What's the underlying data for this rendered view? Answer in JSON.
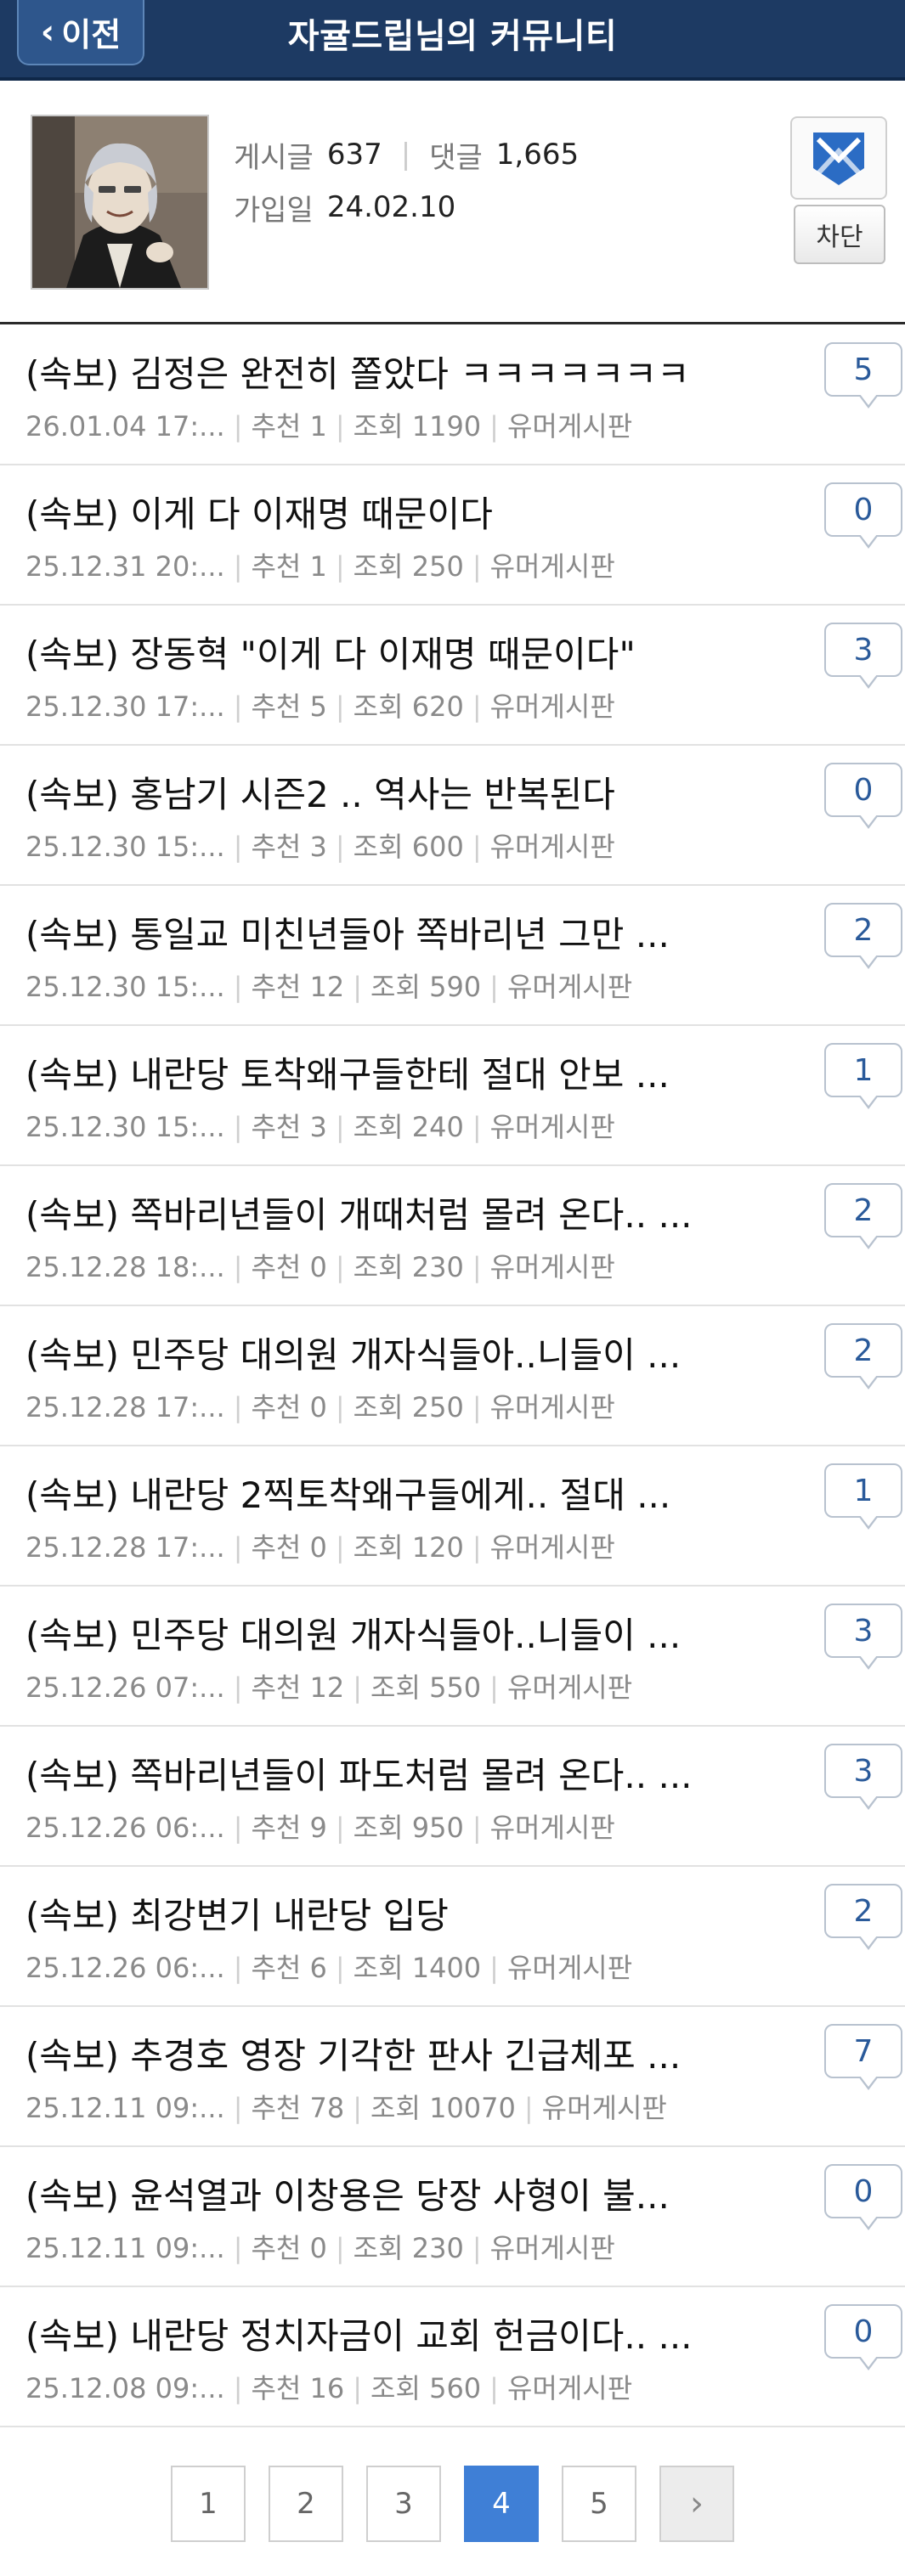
{
  "header": {
    "back_label": "이전",
    "title": "자귤드립님의 커뮤니티"
  },
  "profile": {
    "posts_label": "게시글",
    "posts_value": "637",
    "comments_label": "댓글",
    "comments_value": "1,665",
    "joined_label": "가입일",
    "joined_value": "24.02.10",
    "block_label": "차단"
  },
  "posts": [
    {
      "title": "(속보) 김정은 완전히 쫄았다 ㅋㅋㅋㅋㅋㅋㅋ",
      "date": "26.01.04  17:...",
      "rec": "추천 1",
      "views": "조회 1190",
      "board": "유머게시판",
      "comments": "5"
    },
    {
      "title": "(속보) 이게 다 이재명 때문이다",
      "date": "25.12.31  20:...",
      "rec": "추천 1",
      "views": "조회 250",
      "board": "유머게시판",
      "comments": "0"
    },
    {
      "title": "(속보) 장동혁 \"이게 다 이재명 때문이다\"",
      "date": "25.12.30  17:...",
      "rec": "추천 5",
      "views": "조회 620",
      "board": "유머게시판",
      "comments": "3"
    },
    {
      "title": "(속보) 홍남기 시즌2 .. 역사는 반복된다",
      "date": "25.12.30  15:...",
      "rec": "추천 3",
      "views": "조회 600",
      "board": "유머게시판",
      "comments": "0"
    },
    {
      "title": "(속보) 통일교 미친년들아 쪽바리년 그만 ...",
      "date": "25.12.30  15:...",
      "rec": "추천 12",
      "views": "조회 590",
      "board": "유머게시판",
      "comments": "2"
    },
    {
      "title": "(속보) 내란당 토착왜구들한테 절대 안보 ...",
      "date": "25.12.30  15:...",
      "rec": "추천 3",
      "views": "조회 240",
      "board": "유머게시판",
      "comments": "1"
    },
    {
      "title": "(속보) 쪽바리년들이 개때처럼 몰려 온다.. ...",
      "date": "25.12.28  18:...",
      "rec": "추천 0",
      "views": "조회 230",
      "board": "유머게시판",
      "comments": "2"
    },
    {
      "title": "(속보) 민주당 대의원 개자식들아..니들이 ...",
      "date": "25.12.28  17:...",
      "rec": "추천 0",
      "views": "조회 250",
      "board": "유머게시판",
      "comments": "2"
    },
    {
      "title": "(속보) 내란당 2찍토착왜구들에게.. 절대 ...",
      "date": "25.12.28  17:...",
      "rec": "추천 0",
      "views": "조회 120",
      "board": "유머게시판",
      "comments": "1"
    },
    {
      "title": "(속보) 민주당 대의원 개자식들아..니들이 ...",
      "date": "25.12.26  07:...",
      "rec": "추천 12",
      "views": "조회 550",
      "board": "유머게시판",
      "comments": "3"
    },
    {
      "title": "(속보) 쪽바리년들이 파도처럼 몰려 온다.. ...",
      "date": "25.12.26  06:...",
      "rec": "추천 9",
      "views": "조회 950",
      "board": "유머게시판",
      "comments": "3"
    },
    {
      "title": "(속보) 최강변기 내란당 입당",
      "date": "25.12.26  06:...",
      "rec": "추천 6",
      "views": "조회 1400",
      "board": "유머게시판",
      "comments": "2"
    },
    {
      "title": "(속보) 추경호 영장 기각한 판사 긴급체포 ...",
      "date": "25.12.11  09:...",
      "rec": "추천 78",
      "views": "조회 10070",
      "board": "유머게시판",
      "comments": "7"
    },
    {
      "title": "(속보) 윤석열과 이창용은 당장 사형이 불...",
      "date": "25.12.11  09:...",
      "rec": "추천 0",
      "views": "조회 230",
      "board": "유머게시판",
      "comments": "0"
    },
    {
      "title": "(속보) 내란당 정치자금이 교회 헌금이다.. ...",
      "date": "25.12.08  09:...",
      "rec": "추천 16",
      "views": "조회 560",
      "board": "유머게시판",
      "comments": "0"
    }
  ],
  "pagination": {
    "pages": [
      "1",
      "2",
      "3",
      "4",
      "5"
    ],
    "current": "4",
    "next_icon": "chevron-right-icon"
  },
  "colors": {
    "header_bg": "#1d3a63",
    "active_page": "#3f7fd6",
    "comment_count": "#2a5a9a"
  }
}
